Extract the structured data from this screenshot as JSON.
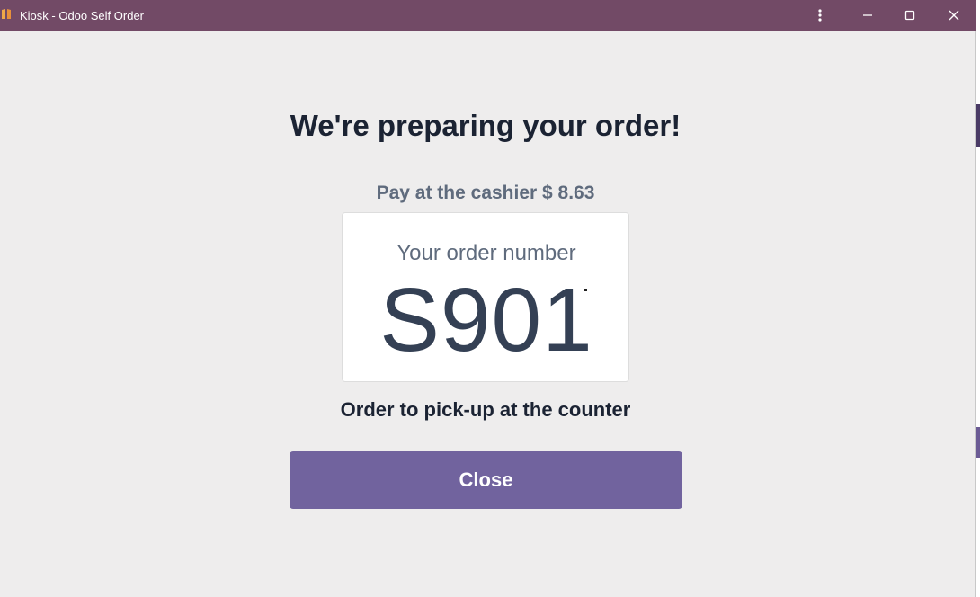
{
  "window": {
    "title": "Kiosk - Odoo Self Order",
    "icons": [
      "app-icon",
      "more-vert-icon",
      "minimize-icon",
      "maximize-icon",
      "close-icon"
    ]
  },
  "confirmation": {
    "heading": "We're preparing your order!",
    "pay_line": "Pay at the cashier $ 8.63",
    "order_label": "Your order number",
    "order_number": "S901",
    "pickup_text": "Order to pick-up at the counter",
    "close_label": "Close"
  },
  "colors": {
    "titlebar": "#724a66",
    "background": "#eeeded",
    "accent_button": "#71639e",
    "heading_text": "#1b2333",
    "muted_text": "#5f6b7d"
  }
}
